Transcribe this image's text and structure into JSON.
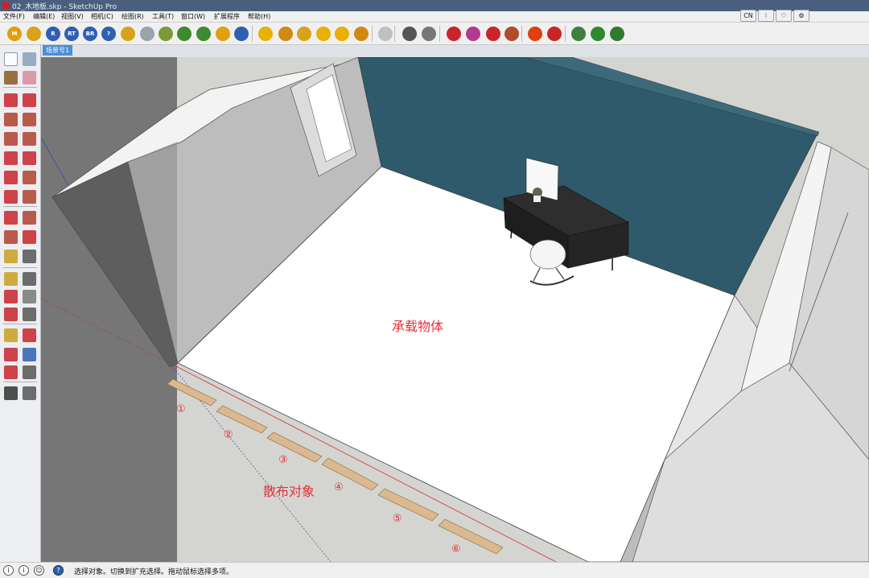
{
  "window": {
    "title": "02_木地板.skp - SketchUp Pro"
  },
  "menu": [
    "文件(F)",
    "编辑(E)",
    "视图(V)",
    "相机(C)",
    "绘图(R)",
    "工具(T)",
    "窗口(W)",
    "扩展程序",
    "帮助(H)"
  ],
  "window_controls": [
    "CN",
    "⁝",
    "♡",
    "⚙"
  ],
  "toolbar_icons": [
    {
      "name": "plugin-m-icon",
      "label": "M",
      "color": "#e0a010"
    },
    {
      "name": "plugin-tag-icon",
      "label": "",
      "color": "#d9a21b"
    },
    {
      "name": "plugin-r-icon",
      "label": "R",
      "color": "#2f5fb0"
    },
    {
      "name": "plugin-rt-icon",
      "label": "RT",
      "color": "#2f5fb0"
    },
    {
      "name": "plugin-br-icon",
      "label": "BR",
      "color": "#2f5fb0"
    },
    {
      "name": "help-icon",
      "label": "?",
      "color": "#2f5fb0"
    },
    {
      "name": "plugin-tag2-icon",
      "label": "",
      "color": "#d9a21b"
    },
    {
      "name": "sphere-icon",
      "label": "",
      "color": "#9aa3ad"
    },
    {
      "name": "scatter-icon",
      "label": "",
      "color": "#7a9a3a"
    },
    {
      "name": "tree-icon",
      "label": "",
      "color": "#3f8a2f"
    },
    {
      "name": "tree2-icon",
      "label": "",
      "color": "#3f8a2f"
    },
    {
      "name": "globe-icon",
      "label": "",
      "color": "#e0a010"
    },
    {
      "name": "pause-icon",
      "label": "",
      "color": "#2f5fb0"
    },
    {
      "name": "light-ball-icon",
      "label": "",
      "color": "#e8b000"
    },
    {
      "name": "spotlight-icon",
      "label": "",
      "color": "#cf8a14"
    },
    {
      "name": "flag-icon",
      "label": "",
      "color": "#d9a21b"
    },
    {
      "name": "lamp-icon",
      "label": "",
      "color": "#e8b000"
    },
    {
      "name": "light-icon",
      "label": "",
      "color": "#e8b000"
    },
    {
      "name": "cone-icon",
      "label": "",
      "color": "#cf8a14"
    },
    {
      "name": "circle-disabled-icon",
      "label": "",
      "color": "#c0c0c0"
    },
    {
      "name": "frame-icon",
      "label": "",
      "color": "#555555"
    },
    {
      "name": "frame2-icon",
      "label": "",
      "color": "#777777"
    },
    {
      "name": "pinwheel-icon",
      "label": "",
      "color": "#c8252b"
    },
    {
      "name": "color-wheel-icon",
      "label": "",
      "color": "#b23a8e"
    },
    {
      "name": "sort-icon",
      "label": "",
      "color": "#c8252b"
    },
    {
      "name": "list-icon",
      "label": "",
      "color": "#b34a2a"
    },
    {
      "name": "gear-icon",
      "label": "",
      "color": "#e04010"
    },
    {
      "name": "grid-icon",
      "label": "",
      "color": "#c8252b"
    },
    {
      "name": "window-icon",
      "label": "",
      "color": "#3f7f3f"
    },
    {
      "name": "leaf-icon",
      "label": "",
      "color": "#2f8a2f"
    },
    {
      "name": "tree-blue-icon",
      "label": "",
      "color": "#2f7a2f"
    }
  ],
  "scene_tab": "场景号1",
  "left_tools": [
    {
      "name": "select-arrow-icon",
      "color": "#222222"
    },
    {
      "name": "component-icon",
      "color": "#8aa0b8"
    },
    {
      "name": "paint-bucket-icon",
      "color": "#8a5a20"
    },
    {
      "name": "eraser-icon",
      "color": "#d98aa0"
    },
    {
      "name": "pencil-icon",
      "color": "#c8252b"
    },
    {
      "name": "freehand-icon",
      "color": "#c8252b"
    },
    {
      "name": "rectangle-icon",
      "color": "#b04030"
    },
    {
      "name": "rotated-rect-icon",
      "color": "#b04030"
    },
    {
      "name": "circle-icon",
      "color": "#b04030"
    },
    {
      "name": "polygon-icon",
      "color": "#b04030"
    },
    {
      "name": "arc-icon",
      "color": "#c8252b"
    },
    {
      "name": "arc2-icon",
      "color": "#c8252b"
    },
    {
      "name": "arc3-icon",
      "color": "#c8252b"
    },
    {
      "name": "pie-icon",
      "color": "#b04030"
    },
    {
      "name": "move-icon",
      "color": "#c8252b"
    },
    {
      "name": "push-pull-icon",
      "color": "#b04030"
    },
    {
      "name": "rotate-icon",
      "color": "#c8252b"
    },
    {
      "name": "follow-me-icon",
      "color": "#b04030"
    },
    {
      "name": "scale-icon",
      "color": "#b04030"
    },
    {
      "name": "offset-icon",
      "color": "#c8252b"
    },
    {
      "name": "tape-measure-icon",
      "color": "#c8a020"
    },
    {
      "name": "dimension-icon",
      "color": "#555555"
    },
    {
      "name": "protractor-icon",
      "color": "#c8a020"
    },
    {
      "name": "text-icon",
      "color": "#555555"
    },
    {
      "name": "axes-icon",
      "color": "#c8252b"
    },
    {
      "name": "3d-text-icon",
      "color": "#777777"
    },
    {
      "name": "orbit-icon",
      "color": "#c8252b"
    },
    {
      "name": "pan-icon",
      "color": "#555555"
    },
    {
      "name": "zoom-icon",
      "color": "#c8a020"
    },
    {
      "name": "zoom-window-icon",
      "color": "#c8252b"
    },
    {
      "name": "zoom-extents-icon",
      "color": "#c8252b"
    },
    {
      "name": "previous-view-icon",
      "color": "#2f5fb0"
    },
    {
      "name": "position-camera-icon",
      "color": "#c8252b"
    },
    {
      "name": "look-around-icon",
      "color": "#555555"
    },
    {
      "name": "walk-icon",
      "color": "#333333"
    },
    {
      "name": "section-plane-icon",
      "color": "#555555"
    }
  ],
  "annotations": {
    "carrier_object": "承载物体",
    "scatter_object": "散布对象",
    "numbers": [
      "①",
      "②",
      "③",
      "④",
      "⑤",
      "⑥"
    ]
  },
  "status": {
    "icons": [
      "i",
      "i",
      "☺",
      "?"
    ],
    "text": "选择对象。切换到扩充选择。拖动鼠标选择多项。"
  }
}
